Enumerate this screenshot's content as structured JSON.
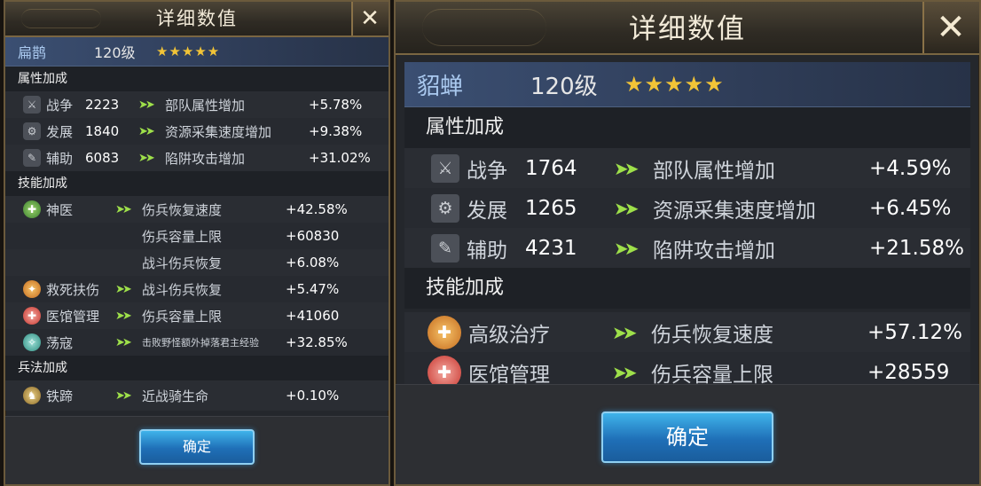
{
  "left": {
    "title": "详细数值",
    "close_icon": "close-icon",
    "hero": {
      "name": "扁鹊",
      "level": "120级",
      "stars": "★★★★★"
    },
    "attr_header": "属性加成",
    "attrs": [
      {
        "icon": "war-icon",
        "glyph": "⚔",
        "name": "战争",
        "value": "2223",
        "effect": "部队属性增加",
        "bonus": "+5.78%"
      },
      {
        "icon": "develop-icon",
        "glyph": "⚙",
        "name": "发展",
        "value": "1840",
        "effect": "资源采集速度增加",
        "bonus": "+9.38%"
      },
      {
        "icon": "assist-icon",
        "glyph": "✎",
        "name": "辅助",
        "value": "6083",
        "effect": "陷阱攻击增加",
        "bonus": "+31.02%"
      }
    ],
    "skill_header": "技能加成",
    "skills": [
      {
        "name": "神医",
        "effect": "伤兵恢复速度",
        "bonus": "+42.58%"
      },
      {
        "name": "",
        "effect": "伤兵容量上限",
        "bonus": "+60830"
      },
      {
        "name": "",
        "effect": "战斗伤兵恢复",
        "bonus": "+6.08%"
      },
      {
        "name": "救死扶伤",
        "effect": "战斗伤兵恢复",
        "bonus": "+5.47%"
      },
      {
        "name": "医馆管理",
        "effect": "伤兵容量上限",
        "bonus": "+41060"
      },
      {
        "name": "荡寇",
        "effect": "击败野怪额外掉落君主经验",
        "bonus": "+32.85%"
      }
    ],
    "tactic_header": "兵法加成",
    "tactics": [
      {
        "name": "铁蹄",
        "effect": "近战骑生命",
        "bonus": "+0.10%"
      }
    ],
    "confirm": "确定"
  },
  "right": {
    "title": "详细数值",
    "close_icon": "close-icon",
    "hero": {
      "name": "貂蝉",
      "level": "120级",
      "stars": "★★★★★"
    },
    "attr_header": "属性加成",
    "attrs": [
      {
        "name": "战争",
        "value": "1764",
        "effect": "部队属性增加",
        "bonus": "+4.59%"
      },
      {
        "name": "发展",
        "value": "1265",
        "effect": "资源采集速度增加",
        "bonus": "+6.45%"
      },
      {
        "name": "辅助",
        "value": "4231",
        "effect": "陷阱攻击增加",
        "bonus": "+21.58%"
      }
    ],
    "skill_header": "技能加成",
    "skills": [
      {
        "name": "高级治疗",
        "effect": "伤兵恢复速度",
        "bonus": "+57.12%"
      },
      {
        "name": "医馆管理",
        "effect": "伤兵容量上限",
        "bonus": "+28559"
      }
    ],
    "confirm": "确定"
  },
  "arrow_glyph": "➤➤",
  "colors": {
    "hero_name": "#aac9ef",
    "stars": "#f2c437",
    "arrow": "#9ee04a",
    "button": "#1f6fb7"
  }
}
